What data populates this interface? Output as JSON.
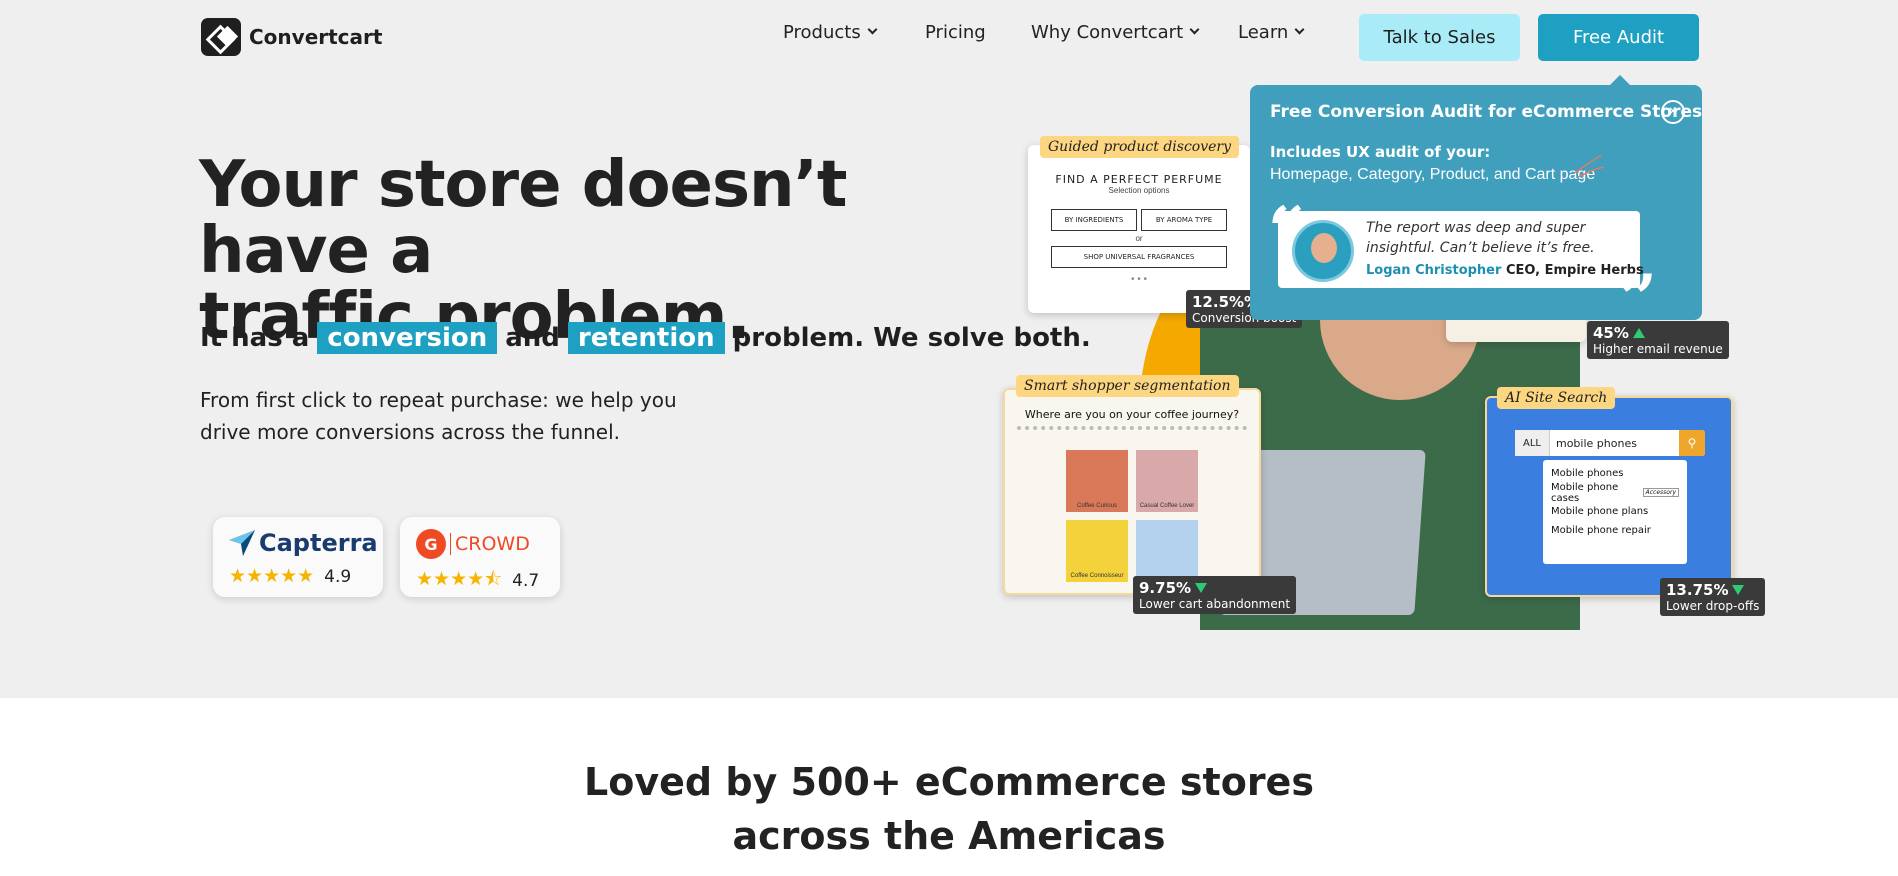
{
  "header": {
    "brand": "Convertcart",
    "nav": [
      {
        "label": "Products",
        "dropdown": true
      },
      {
        "label": "Pricing",
        "dropdown": false
      },
      {
        "label": "Why Convertcart",
        "dropdown": true
      },
      {
        "label": "Learn",
        "dropdown": true
      }
    ],
    "talk_to_sales": "Talk to Sales",
    "free_audit": "Free Audit"
  },
  "hero": {
    "headline_line1": "Your store doesn’t have a",
    "headline_line2": "traffic problem.",
    "sub_prefix": "It has a",
    "sub_hl1": "conversion",
    "sub_mid": "and",
    "sub_hl2": "retention",
    "sub_suffix": "problem. We solve both.",
    "desc_line1": "From first click to repeat purchase: we help you",
    "desc_line2": "drive more conversions across the funnel."
  },
  "ratings": [
    {
      "brand": "Capterra",
      "score": "4.9",
      "stars": 5,
      "color": "#1a3b6e"
    },
    {
      "brand_g2": "G",
      "brand_crowd": "CROWD",
      "score": "4.7",
      "stars": 4.5,
      "color": "#ef4a23"
    }
  ],
  "visual": {
    "guided": {
      "tag": "Guided product discovery",
      "title": "FIND A PERFECT PERFUME",
      "subtitle": "Selection options",
      "btn1": "BY INGREDIENTS",
      "btn2": "BY AROMA TYPE",
      "or": "or",
      "btn3": "SHOP UNIVERSAL FRAGRANCES",
      "stat_value": "12.5%%",
      "stat_label": "Conversion boost"
    },
    "email_stat": {
      "value": "45%",
      "label": "Higher email revenue"
    },
    "smart": {
      "tag": "Smart shopper segmentation",
      "title": "Where are you on your coffee journey?",
      "tiles": [
        "Coffee Curious",
        "Casual Coffee Lover",
        "Coffee Connoisseur",
        ""
      ],
      "stat_value": "9.75%",
      "stat_label": "Lower cart abandonment"
    },
    "search": {
      "tag": "AI Site Search",
      "scope": "ALL",
      "query": "mobile phones",
      "results": [
        "Mobile phones",
        "Mobile phone cases",
        "Mobile phone plans",
        "Mobile phone repair"
      ],
      "result_badge": "Accessory",
      "stat_value": "13.75%",
      "stat_label": "Lower drop-offs"
    }
  },
  "popup": {
    "title": "Free Conversion Audit for eCommerce Stores",
    "includes": "Includes UX audit of your:",
    "pages": "Homepage, Category, Product, and Cart page",
    "quote": "The report was deep and super insightful. Can’t believe it’s free.",
    "author": "Logan Christopher",
    "role": "CEO, Empire Herbs"
  },
  "section": {
    "line1": "Loved by 500+ eCommerce stores",
    "line2": "across the Americas"
  },
  "colors": {
    "accent": "#1da0c1",
    "sales_bg": "#a9ecf8",
    "popup_bg": "#3f9fbd",
    "tag_bg": "#fcd680",
    "circle": "#f4a800"
  }
}
